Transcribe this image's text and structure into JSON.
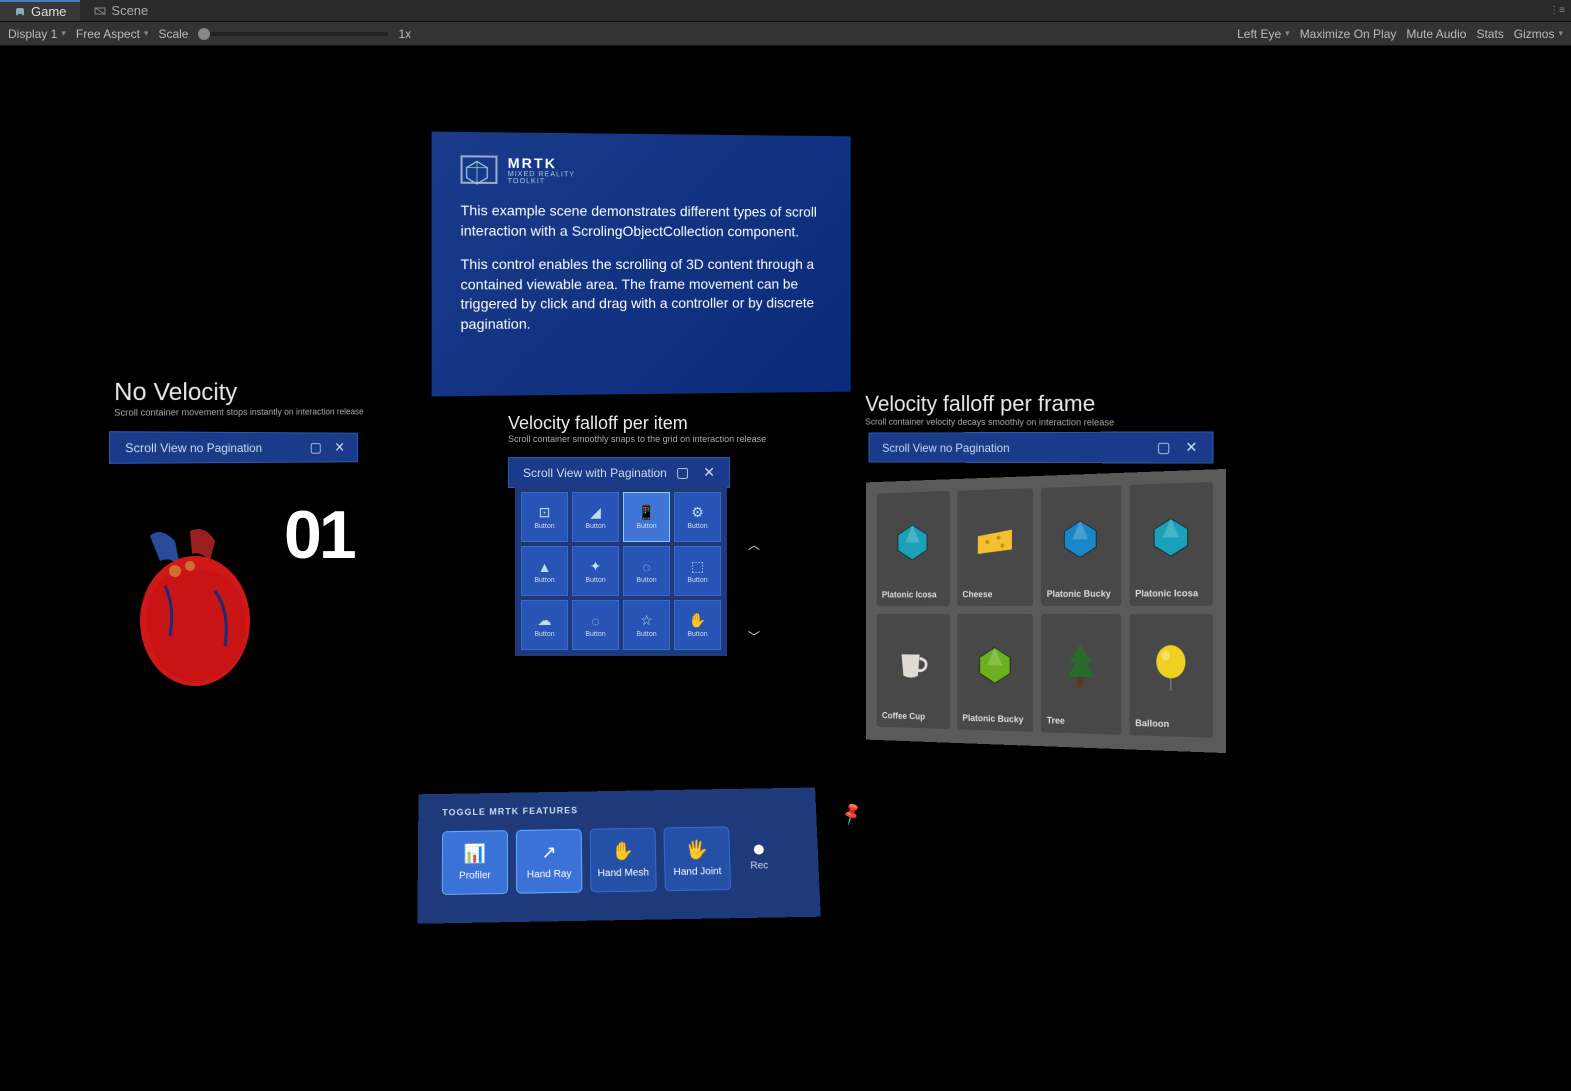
{
  "tabs": {
    "game": "Game",
    "scene": "Scene"
  },
  "toolbar": {
    "display": "Display 1",
    "aspect": "Free Aspect",
    "scale_label": "Scale",
    "scale_value": "1x",
    "eye": "Left Eye",
    "maximize": "Maximize On Play",
    "mute": "Mute Audio",
    "stats": "Stats",
    "gizmos": "Gizmos"
  },
  "info": {
    "logo_title": "MRTK",
    "logo_sub1": "MIXED REALITY",
    "logo_sub2": "TOOLKIT",
    "p1": "This example scene demonstrates different types of scroll interaction with a ScrolingObjectCollection component.",
    "p2": "This control enables the scrolling of 3D content through a contained viewable area. The frame movement can be triggered by click and drag with a controller or by discrete pagination."
  },
  "sections": {
    "novel": {
      "title": "No Velocity",
      "sub": "Scroll container movement stops instantly on interaction release"
    },
    "peritem": {
      "title": "Velocity falloff per item",
      "sub": "Scroll container smoothly snaps to the grid on interaction release"
    },
    "perframe": {
      "title": "Velocity falloff per frame",
      "sub": "Scroll container velocity decays smoothly on interaction release"
    }
  },
  "windows": {
    "w1": "Scroll View no Pagination",
    "w2": "Scroll View with Pagination",
    "w3": "Scroll View no Pagination"
  },
  "big_number": "01",
  "grid_items": [
    {
      "icon": "⊡",
      "label": "Button"
    },
    {
      "icon": "◢",
      "label": "Button"
    },
    {
      "icon": "📱",
      "label": "Button",
      "highlight": true
    },
    {
      "icon": "⚙",
      "label": "Button"
    },
    {
      "icon": "▲",
      "label": "Button"
    },
    {
      "icon": "✦",
      "label": "Button"
    },
    {
      "icon": "◌",
      "label": "Button"
    },
    {
      "icon": "⬚",
      "label": "Button"
    },
    {
      "icon": "☁",
      "label": "Button"
    },
    {
      "icon": "◌",
      "label": "Button"
    },
    {
      "icon": "☆",
      "label": "Button"
    },
    {
      "icon": "✋",
      "label": "Button"
    }
  ],
  "gallery": [
    {
      "label": "Platonic Icosa",
      "color": "#1aa0b8",
      "shape": "poly"
    },
    {
      "label": "Cheese",
      "color": "#f2c030",
      "shape": "cheese"
    },
    {
      "label": "Platonic Bucky",
      "color": "#1a88c8",
      "shape": "poly"
    },
    {
      "label": "Platonic Icosa",
      "color": "#1aa0b8",
      "shape": "poly"
    },
    {
      "label": "Coffee Cup",
      "color": "#e0dcd4",
      "shape": "cup"
    },
    {
      "label": "Platonic Bucky",
      "color": "#6ab020",
      "shape": "poly"
    },
    {
      "label": "Tree",
      "color": "#2a6a2a",
      "shape": "tree"
    },
    {
      "label": "Balloon",
      "color": "#f0d020",
      "shape": "balloon"
    }
  ],
  "toggles": {
    "title": "TOGGLE MRTK FEATURES",
    "items": [
      {
        "icon": "📊",
        "label": "Profiler",
        "on": true
      },
      {
        "icon": "↗",
        "label": "Hand Ray",
        "on": true
      },
      {
        "icon": "✋",
        "label": "Hand Mesh",
        "on": false
      },
      {
        "icon": "🖐",
        "label": "Hand Joint",
        "on": false
      }
    ],
    "rec": "Rec"
  }
}
